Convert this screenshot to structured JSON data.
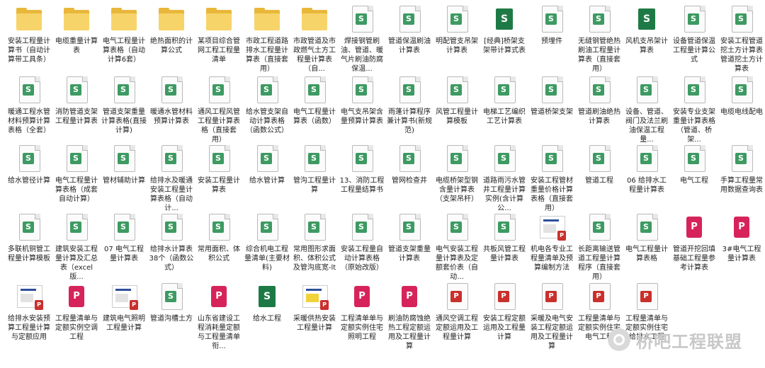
{
  "files": [
    {
      "label": "安装工程量计算书（自动计算带工具条）",
      "type": "folder"
    },
    {
      "label": "电缆重量计算表",
      "type": "folder"
    },
    {
      "label": "电气工程量计算表格（自动计算6套）",
      "type": "folder"
    },
    {
      "label": "绝热面积的计算公式",
      "type": "folder"
    },
    {
      "label": "某项目综合管网工程工程量清单",
      "type": "folder"
    },
    {
      "label": "市政工程道路排水工程量计算表（直接套用）",
      "type": "folder"
    },
    {
      "label": "市政管道及市政燃气土方工程量计算表（自...",
      "type": "folder"
    },
    {
      "label": "焊接钢管刷油、管道、暖气片刷油防腐保温...",
      "type": "sheet"
    },
    {
      "label": "管道保温刷油计算表",
      "type": "sheet"
    },
    {
      "label": "明配管支吊架计算表",
      "type": "sheet"
    },
    {
      "label": "[经典]桥架支架带计算式表",
      "type": "sheet-full"
    },
    {
      "label": "预埋件",
      "type": "sheet"
    },
    {
      "label": "无缝钢管绝热刷油工程量计算表（直接套用）",
      "type": "sheet"
    },
    {
      "label": "风机支吊架计算表",
      "type": "sheet-full"
    },
    {
      "label": "设备管道保温工程量计算公式",
      "type": "sheet"
    },
    {
      "label": "安装工程管道挖土方计算表管道挖土方计算表",
      "type": "sheet"
    },
    {
      "label": "暖通工程水管材料预算计算表格（全套）",
      "type": "sheet"
    },
    {
      "label": "消防管道支架工程量计算表",
      "type": "sheet"
    },
    {
      "label": "管道支架重量计算表格(直接计算)",
      "type": "sheet"
    },
    {
      "label": "暖通水管材料预算计算表",
      "type": "sheet"
    },
    {
      "label": "通风工程风管工程量计算表格（直接套用）",
      "type": "sheet"
    },
    {
      "label": "给水管支架自动计算表格（函数公式）",
      "type": "sheet"
    },
    {
      "label": "电气工程量计算表（函数）",
      "type": "sheet"
    },
    {
      "label": "电气支吊架含量预算计算表",
      "type": "sheet"
    },
    {
      "label": "雨蓬计算程序兼计算书(新规范)",
      "type": "sheet"
    },
    {
      "label": "风管工程量计算模板",
      "type": "sheet"
    },
    {
      "label": "电梯工艺编织工艺计算表",
      "type": "sheet"
    },
    {
      "label": "管道桥架支架",
      "type": "sheet"
    },
    {
      "label": "管道刷油绝热计算表",
      "type": "sheet"
    },
    {
      "label": "设备、管道、阀门及法兰刷油保温工程量...",
      "type": "sheet"
    },
    {
      "label": "安装专业支架重量计算表格（管道、桥架...",
      "type": "sheet"
    },
    {
      "label": "电缆电线配电",
      "type": "sheet"
    },
    {
      "label": "给水管径计算",
      "type": "sheet"
    },
    {
      "label": "电气工程量计算表格（成套自动计算）",
      "type": "sheet"
    },
    {
      "label": "管材辅助计算",
      "type": "sheet"
    },
    {
      "label": "给排水及暖通安装工程量计算表格（自动计...",
      "type": "sheet"
    },
    {
      "label": "安装工程量计算表",
      "type": "sheet"
    },
    {
      "label": "给水管计算",
      "type": "sheet"
    },
    {
      "label": "管沟工程量计算",
      "type": "sheet"
    },
    {
      "label": "13、消防工程工程量结算书",
      "type": "sheet"
    },
    {
      "label": "管网检查井",
      "type": "sheet"
    },
    {
      "label": "电缆桥架型钢含量计算表（支架吊杆）",
      "type": "sheet"
    },
    {
      "label": "道路雨污水管井工程量计算实例(含计算公...",
      "type": "sheet"
    },
    {
      "label": "安装工程管材重量价格计算表格（直接套用）",
      "type": "sheet"
    },
    {
      "label": "管道工程",
      "type": "sheet"
    },
    {
      "label": "06 给排水工程量计算表",
      "type": "sheet"
    },
    {
      "label": "电气工程",
      "type": "sheet"
    },
    {
      "label": "手算工程量常用数据查询表",
      "type": "sheet"
    },
    {
      "label": "多联机铜管工程量计算模板",
      "type": "sheet"
    },
    {
      "label": "建筑安装工程量计算及汇总表（excel版...",
      "type": "sheet"
    },
    {
      "label": "07 电气工程量计算表",
      "type": "sheet"
    },
    {
      "label": "给排水计算表38个（函数公式）",
      "type": "sheet"
    },
    {
      "label": "常用面积、体积公式",
      "type": "sheet"
    },
    {
      "label": "综合机电工程量清单(主要材料)",
      "type": "sheet"
    },
    {
      "label": "常用图形求面积、体积公式及管沟底宽-lt",
      "type": "sheet"
    },
    {
      "label": "安装工程量自动计算表格（原始改版）",
      "type": "sheet"
    },
    {
      "label": "管道支架重量计算表",
      "type": "sheet"
    },
    {
      "label": "电气安装工程量计算表及定额套价表（自动...",
      "type": "sheet"
    },
    {
      "label": "共板风管工程量计算表",
      "type": "sheet"
    },
    {
      "label": "机电各专业工程量清单及预算编制方法",
      "type": "thumb"
    },
    {
      "label": "长距离输送管道工程量计算程序（直接套用）",
      "type": "sheet"
    },
    {
      "label": "电气工程量计算表格",
      "type": "sheet"
    },
    {
      "label": "管道开挖回填基础工程量参考计算表",
      "type": "pdf-red"
    },
    {
      "label": "3#电气工程量计算表",
      "type": "pdf-red"
    },
    {
      "label": "给排水安装预算工程量计算与定额应用",
      "type": "thumb"
    },
    {
      "label": "工程量清单与定额实例空调工程",
      "type": "pdf-red"
    },
    {
      "label": "建筑电气照明工程量计算",
      "type": "thumb"
    },
    {
      "label": "管道沟槽土方",
      "type": "sheet"
    },
    {
      "label": "山东省建设工程消耗量定额与工程量清单衔...",
      "type": "pdf-red"
    },
    {
      "label": "给水工程",
      "type": "sheet-full"
    },
    {
      "label": "采暖供热安装工程量计算",
      "type": "thumb-y"
    },
    {
      "label": "工程清单单与定额实例住宅照明工程",
      "type": "pdf-red"
    },
    {
      "label": "刷油防腐蚀绝热工程定额运用及工程量计算",
      "type": "pdf-red"
    },
    {
      "label": "通风空调工程定额运用及工程量计算",
      "type": "pdf"
    },
    {
      "label": "安装工程定额运用及工程量计算",
      "type": "pdf"
    },
    {
      "label": "采暖及电气安装工程定额运用及工程量计算",
      "type": "pdf"
    },
    {
      "label": "工程量清单与定额实例住宅电气工程",
      "type": "pdf"
    },
    {
      "label": "工程量清单与定额实例住宅给排水工程",
      "type": "pdf"
    }
  ],
  "icons": {
    "sheet": "S",
    "pdf": "P"
  },
  "watermark": {
    "text": "桥吧工程联盟",
    "logo": "watermark-logo-icon"
  }
}
